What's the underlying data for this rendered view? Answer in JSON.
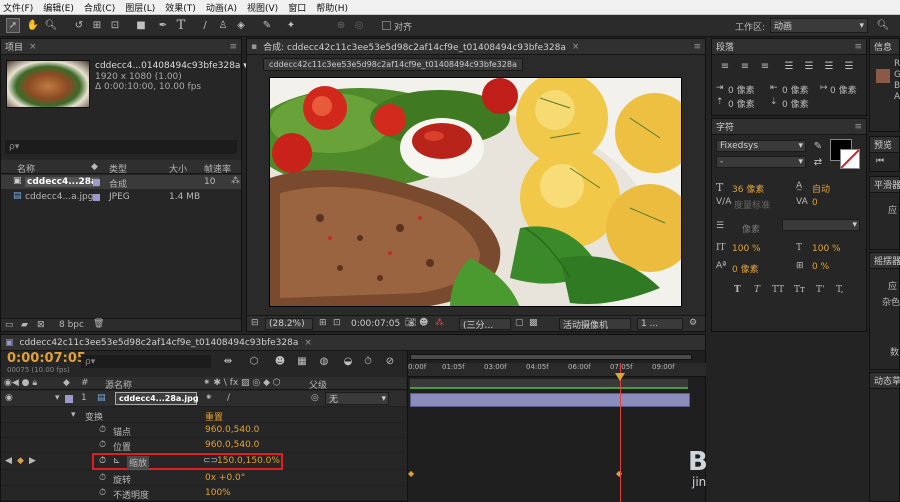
{
  "menubar": {
    "items": [
      "文件(F)",
      "编辑(E)",
      "合成(C)",
      "图层(L)",
      "效果(T)",
      "动画(A)",
      "视图(V)",
      "窗口",
      "帮助(H)"
    ],
    "align_label": "对齐",
    "workspace_label": "工作区:",
    "workspace_value": "动画"
  },
  "project": {
    "tab": "项目",
    "item_name": "cddecc4...01408494c93bfe328a ▾",
    "item_res": "1920 x 1080 (1.00)",
    "item_dur": "Δ 0:00:10:00, 10.00 fps",
    "search_placeholder": "ρ▾",
    "col_name": "名称",
    "col_type": "类型",
    "col_size": "大小",
    "col_rate": "帧速率",
    "rows": [
      {
        "name": "cddecc4...28a",
        "type": "合成",
        "size": "",
        "rate": "10"
      },
      {
        "name": "cddecc4...a.jpg",
        "type": "JPEG",
        "size": "1.4 MB",
        "rate": ""
      }
    ],
    "bpc": "8 bpc"
  },
  "composition": {
    "tab": "合成: cddecc42c11c3ee53e5d98c2af14cf9e_t01408494c93bfe328a",
    "subtab": "cddecc42c11c3ee53e5d98c2af14cf9e_t01408494c93bfe328a",
    "zoom": "(28.2%)",
    "timecode": "0:00:07:05",
    "resolution": "(三分...",
    "camera": "活动摄像机",
    "views": "1 ..."
  },
  "paragraph": {
    "tab": "段落",
    "indent_values": [
      "0 像素",
      "0 像素",
      "0 像素",
      "0 像素",
      "0 像素"
    ]
  },
  "character": {
    "tab": "字符",
    "font": "Fixedsys",
    "style": "-",
    "size": "36 像素",
    "leading": "自动",
    "kerning": "度量标准",
    "tracking": "0",
    "stroke_width": "像素",
    "stroke_type": "",
    "v_scale": "100 %",
    "h_scale": "100 %",
    "baseline": "0 像素",
    "tsume": "0 %",
    "styles": [
      "T",
      "T",
      "TT",
      "Tт",
      "T'",
      "T,"
    ]
  },
  "right_strip": {
    "info_tab": "信息",
    "preview_tab": "预览",
    "smooth_tab": "平滑器",
    "smooth_apply": "应",
    "wiggle_tab": "摇摆器",
    "wiggle_apply": "应",
    "wiggle_noise": "杂色",
    "wiggle_num": "数",
    "motion_tab": "动态草",
    "info_letters": [
      "R",
      "G",
      "B",
      "A"
    ]
  },
  "timeline": {
    "tab": "cddecc42c11c3ee53e5d98c2af14cf9e_t01408494c93bfe328a",
    "timecode": "0:00:07:05",
    "frame_info": "00075 (10.00 fps)",
    "search_placeholder": "ρ▾",
    "col_source": "源名称",
    "col_parent": "父级",
    "layer_num": "1",
    "layer_name": "cddecc4...28a.jpg",
    "parent_value": "无",
    "transform_label": "变换",
    "reset_label": "重置",
    "props": [
      {
        "name": "锚点",
        "value": "960.0,540.0"
      },
      {
        "name": "位置",
        "value": "960.0,540.0"
      },
      {
        "name": "缩放",
        "value": "150.0,150.0%"
      },
      {
        "name": "旋转",
        "value": "0x +0.0°"
      },
      {
        "name": "不透明度",
        "value": "100%"
      }
    ],
    "ruler": [
      "0:00f",
      "01:05f",
      "03:00f",
      "04:05f",
      "06:00f",
      "07:05f",
      "09:00f"
    ]
  },
  "watermark": {
    "big": "B",
    "small": "jin"
  },
  "colors": {
    "accent": "#e0a13a",
    "highlight_box": "#e02020",
    "playhead": "#e04040",
    "workarea": "#4a9b3a",
    "layer_bar": "#8a8dbb"
  }
}
